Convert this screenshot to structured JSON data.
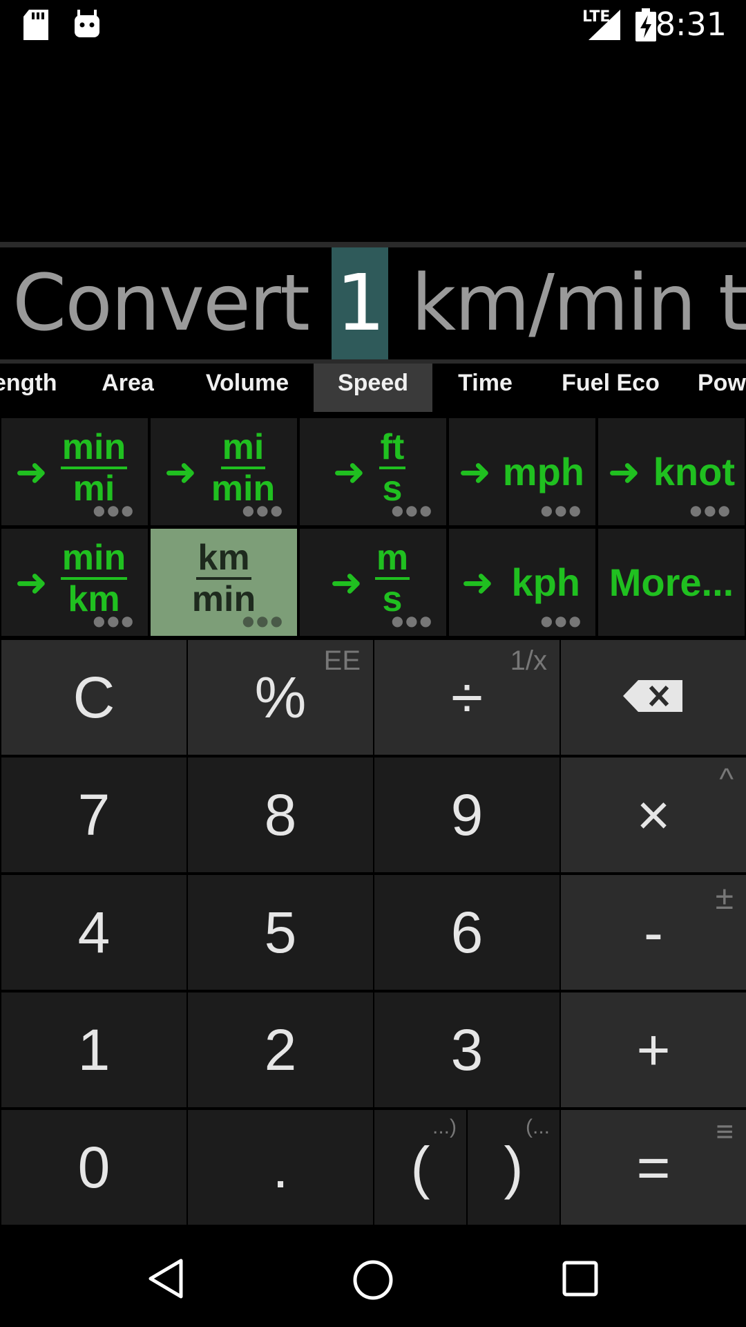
{
  "status_bar": {
    "time": "8:31",
    "network": "LTE"
  },
  "display": {
    "prefix": "Convert",
    "value": "1",
    "suffix": "km/min to:"
  },
  "tabs": [
    "ength",
    "Area",
    "Volume",
    "Speed",
    "Time",
    "Fuel Eco",
    "Pow"
  ],
  "active_tab": "Speed",
  "units": [
    {
      "kind": "frac",
      "num": "min",
      "den": "mi"
    },
    {
      "kind": "frac",
      "num": "mi",
      "den": "min"
    },
    {
      "kind": "frac",
      "num": "ft",
      "den": "s"
    },
    {
      "kind": "single",
      "label": "mph"
    },
    {
      "kind": "single",
      "label": "knot"
    },
    {
      "kind": "frac",
      "num": "min",
      "den": "km"
    },
    {
      "kind": "frac",
      "num": "km",
      "den": "min",
      "selected": true
    },
    {
      "kind": "frac",
      "num": "m",
      "den": "s"
    },
    {
      "kind": "single",
      "label": "kph"
    },
    {
      "kind": "more",
      "label": "More..."
    }
  ],
  "keys": {
    "clear": "C",
    "percent": "%",
    "percent_alt": "EE",
    "divide": "÷",
    "divide_alt": "1/x",
    "backspace": "⌫",
    "d7": "7",
    "d8": "8",
    "d9": "9",
    "multiply": "×",
    "multiply_alt": "^",
    "d4": "4",
    "d5": "5",
    "d6": "6",
    "minus": "-",
    "minus_alt": "±",
    "d1": "1",
    "d2": "2",
    "d3": "3",
    "plus": "+",
    "d0": "0",
    "dot": ".",
    "open_paren": "(",
    "open_paren_alt": "...)",
    "close_paren": ")",
    "close_paren_alt": "(...",
    "equals": "=",
    "equals_alt": "≡"
  },
  "colors": {
    "accent_green": "#20c020",
    "selected_unit_bg": "#7d9e78",
    "value_highlight": "#2f5a5a"
  }
}
